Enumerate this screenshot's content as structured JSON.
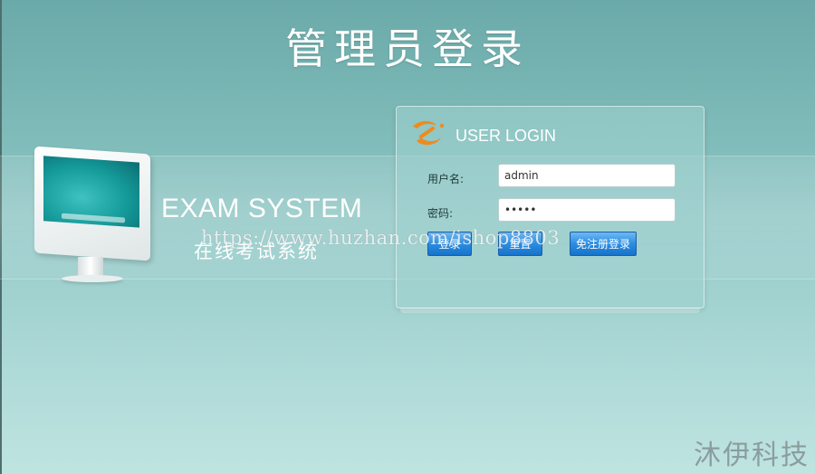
{
  "page": {
    "title": "管理员登录"
  },
  "hero": {
    "title": "EXAM SYSTEM",
    "subtitle": "在线考试系统"
  },
  "login": {
    "heading": "USER LOGIN",
    "username_label": "用户名:",
    "username_value": "admin",
    "password_label": "密码:",
    "password_value": "•••••",
    "buttons": {
      "login": "登录",
      "reset": "重置",
      "free_login": "免注册登录"
    }
  },
  "overlay": {
    "watermark": "https://www.huzhan.com/ishop8803",
    "brand": "沐伊科技"
  },
  "colors": {
    "background_top": "#6aaaa9",
    "background_bottom": "#bfe4e1",
    "button": "#2b8de2",
    "logo_orange": "#f08a1c"
  },
  "icons": {
    "logo": "swirl-logo-icon",
    "computer": "computer-monitor-icon"
  }
}
